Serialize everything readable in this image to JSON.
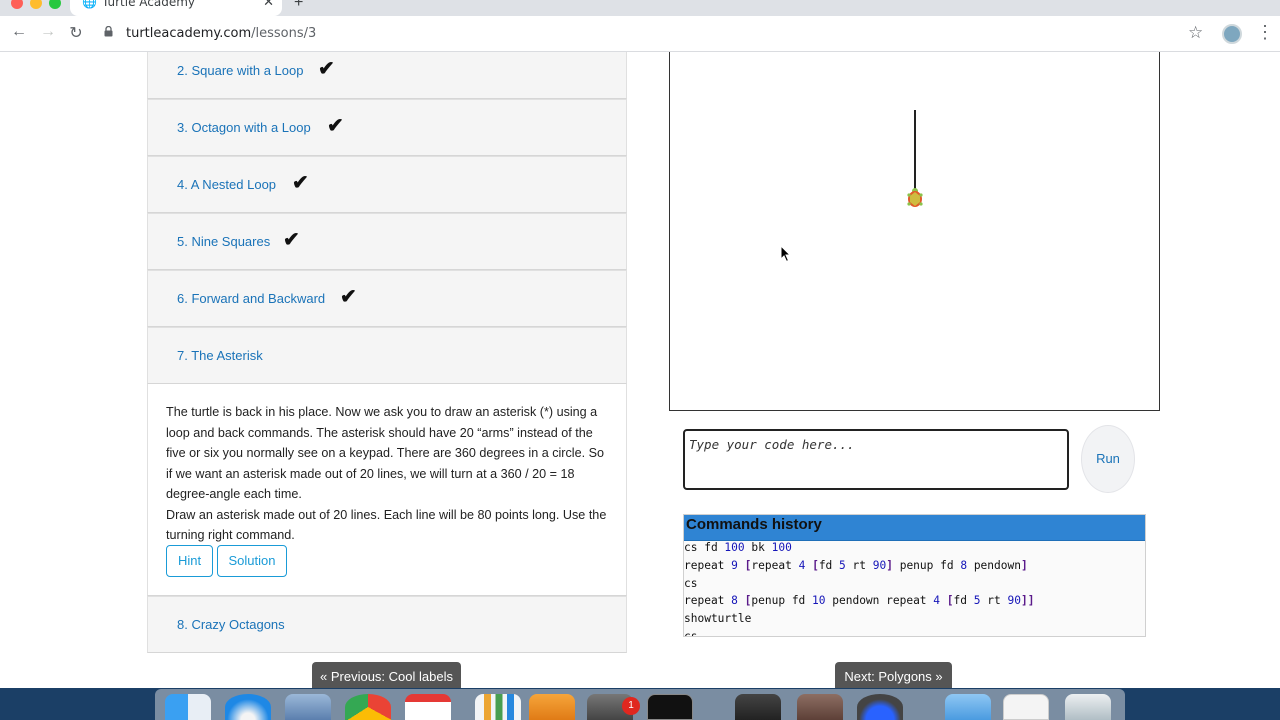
{
  "browser": {
    "tab_title": "Turtle Academy",
    "url_host": "turtleacademy.com",
    "url_path": "/lessons/3"
  },
  "lessons": [
    {
      "label": "2. Square with a Loop",
      "done": true
    },
    {
      "label": "3. Octagon with a Loop",
      "done": true
    },
    {
      "label": "4. A Nested Loop",
      "done": true
    },
    {
      "label": "5. Nine Squares",
      "done": true
    },
    {
      "label": "6. Forward and Backward",
      "done": true
    },
    {
      "label": "7. The Asterisk",
      "done": false
    },
    {
      "label": "8. Crazy Octagons",
      "done": false
    }
  ],
  "active_lesson": {
    "paragraph1": "The turtle is back in his place. Now we ask you to draw an asterisk (*) using a loop and back commands. The asterisk should have 20 “arms” instead of the five or six you normally see on a keypad. There are 360 degrees in a circle. So if we want an asterisk made out of 20 lines, we will turn at a 360 / 20 = 18 degree-angle each time.",
    "paragraph2": "Draw an asterisk made out of 20 lines. Each line will be 80 points long. Use the turning right command.",
    "hint_label": "Hint",
    "solution_label": "Solution"
  },
  "editor": {
    "placeholder": "Type your code here...",
    "run_label": "Run"
  },
  "history": {
    "title": "Commands history",
    "lines": [
      "cs fd 100 bk 100",
      "repeat 9 [repeat 4 [fd 5 rt 90] penup fd 8 pendown]",
      "cs",
      "repeat 8 [penup fd 10 pendown repeat 4 [fd 5 rt 90]]",
      "showturtle",
      "cs"
    ]
  },
  "nav": {
    "prev_label": "« Previous: Cool labels",
    "next_label": "Next: Polygons »"
  },
  "dock": {
    "mail_badge": "1"
  },
  "colors": {
    "link": "#1a73b8",
    "history_header": "#2f84d3",
    "outline_button": "#1a9bd7"
  },
  "icons": {
    "check": "check-icon",
    "lock": "lock-icon",
    "star": "star-icon",
    "globe": "globe-icon"
  }
}
